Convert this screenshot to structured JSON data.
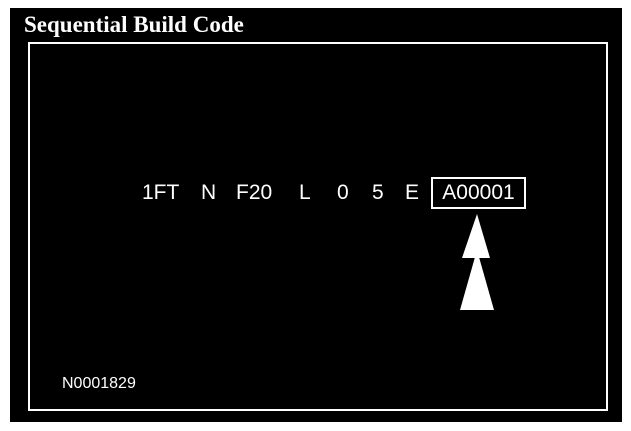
{
  "title": "Sequential Build Code",
  "vin_segments": [
    "1FT",
    "N",
    "F20",
    "L",
    "0",
    "5",
    "E"
  ],
  "highlighted_segment": "A00001",
  "figure_id": "N0001829",
  "colors": {
    "background": "#000000",
    "foreground": "#ffffff",
    "page": "#ffffff"
  },
  "icons": {
    "pointer": "up-arrow-icon"
  }
}
